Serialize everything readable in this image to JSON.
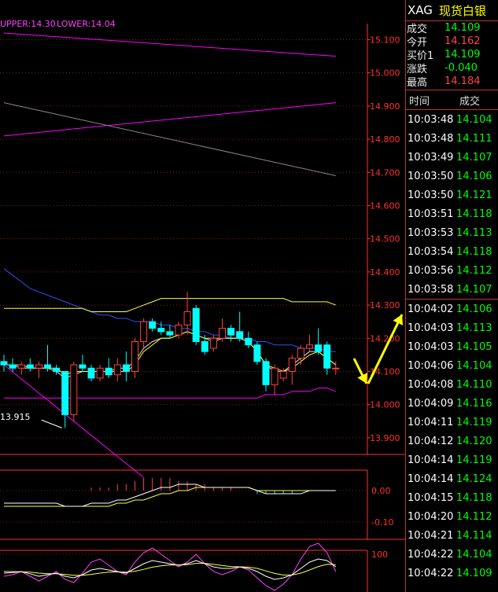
{
  "indicator": {
    "upper_label": "UPPER:14.30",
    "lower_label": "LOWER:14.04"
  },
  "colors": {
    "up": "#ff4040",
    "down": "#00ffff",
    "upper": "#ff00ff",
    "lower": "#ff00ff",
    "ma_yellow": "#ffff40",
    "ma_blue": "#3050ff",
    "axis": "#ff3030"
  },
  "chart_data": [
    {
      "type": "candlestick",
      "y_ticks": [
        "15.100",
        "15.000",
        "14.900",
        "14.800",
        "14.700",
        "14.600",
        "14.500",
        "14.400",
        "14.300",
        "14.200",
        "14.100",
        "14.000",
        "13.900"
      ],
      "ylim": [
        13.85,
        15.12
      ],
      "low_marker_label": "13.915",
      "candles": [
        {
          "o": 14.13,
          "h": 14.15,
          "l": 14.1,
          "c": 14.12
        },
        {
          "o": 14.12,
          "h": 14.14,
          "l": 14.1,
          "c": 14.11
        },
        {
          "o": 14.11,
          "h": 14.13,
          "l": 14.09,
          "c": 14.12
        },
        {
          "o": 14.12,
          "h": 14.14,
          "l": 14.1,
          "c": 14.11
        },
        {
          "o": 14.11,
          "h": 14.13,
          "l": 14.08,
          "c": 14.12
        },
        {
          "o": 14.12,
          "h": 14.18,
          "l": 14.1,
          "c": 14.11
        },
        {
          "o": 14.11,
          "h": 14.12,
          "l": 14.09,
          "c": 14.1
        },
        {
          "o": 14.1,
          "h": 14.1,
          "l": 13.93,
          "c": 13.97
        },
        {
          "o": 13.97,
          "h": 14.13,
          "l": 13.95,
          "c": 14.12
        },
        {
          "o": 14.12,
          "h": 14.15,
          "l": 14.1,
          "c": 14.11
        },
        {
          "o": 14.11,
          "h": 14.12,
          "l": 14.07,
          "c": 14.08
        },
        {
          "o": 14.08,
          "h": 14.12,
          "l": 14.07,
          "c": 14.11
        },
        {
          "o": 14.11,
          "h": 14.14,
          "l": 14.08,
          "c": 14.09
        },
        {
          "o": 14.09,
          "h": 14.14,
          "l": 14.07,
          "c": 14.12
        },
        {
          "o": 14.12,
          "h": 14.16,
          "l": 14.07,
          "c": 14.1
        },
        {
          "o": 14.1,
          "h": 14.2,
          "l": 14.08,
          "c": 14.19
        },
        {
          "o": 14.19,
          "h": 14.26,
          "l": 14.17,
          "c": 14.25
        },
        {
          "o": 14.25,
          "h": 14.26,
          "l": 14.22,
          "c": 14.23
        },
        {
          "o": 14.23,
          "h": 14.25,
          "l": 14.21,
          "c": 14.22
        },
        {
          "o": 14.22,
          "h": 14.24,
          "l": 14.2,
          "c": 14.21
        },
        {
          "o": 14.21,
          "h": 14.25,
          "l": 14.2,
          "c": 14.24
        },
        {
          "o": 14.24,
          "h": 14.34,
          "l": 14.21,
          "c": 14.28
        },
        {
          "o": 14.29,
          "h": 14.3,
          "l": 14.18,
          "c": 14.19
        },
        {
          "o": 14.19,
          "h": 14.21,
          "l": 14.15,
          "c": 14.16
        },
        {
          "o": 14.17,
          "h": 14.21,
          "l": 14.16,
          "c": 14.2
        },
        {
          "o": 14.2,
          "h": 14.26,
          "l": 14.19,
          "c": 14.23
        },
        {
          "o": 14.23,
          "h": 14.24,
          "l": 14.19,
          "c": 14.21
        },
        {
          "o": 14.22,
          "h": 14.28,
          "l": 14.19,
          "c": 14.2
        },
        {
          "o": 14.2,
          "h": 14.22,
          "l": 14.17,
          "c": 14.18
        },
        {
          "o": 14.18,
          "h": 14.19,
          "l": 14.12,
          "c": 14.13
        },
        {
          "o": 14.13,
          "h": 14.14,
          "l": 14.04,
          "c": 14.06
        },
        {
          "o": 14.06,
          "h": 14.12,
          "l": 14.03,
          "c": 14.11
        },
        {
          "o": 14.08,
          "h": 14.11,
          "l": 14.07,
          "c": 14.1
        },
        {
          "o": 14.1,
          "h": 14.15,
          "l": 14.06,
          "c": 14.14
        },
        {
          "o": 14.14,
          "h": 14.18,
          "l": 14.12,
          "c": 14.17
        },
        {
          "o": 14.17,
          "h": 14.21,
          "l": 14.16,
          "c": 14.18
        },
        {
          "o": 14.18,
          "h": 14.23,
          "l": 14.15,
          "c": 14.16
        },
        {
          "o": 14.18,
          "h": 14.19,
          "l": 14.09,
          "c": 14.11
        },
        {
          "o": 14.11,
          "h": 14.13,
          "l": 14.09,
          "c": 14.11
        }
      ],
      "bands": {
        "upper": [
          14.29,
          14.29,
          14.29,
          14.29,
          14.29,
          14.29,
          14.29,
          14.29,
          14.29,
          14.29,
          14.28,
          14.28,
          14.28,
          14.28,
          14.28,
          14.29,
          14.3,
          14.31,
          14.32,
          14.32,
          14.32,
          14.32,
          14.32,
          14.32,
          14.32,
          14.32,
          14.32,
          14.32,
          14.32,
          14.32,
          14.32,
          14.32,
          14.32,
          14.31,
          14.31,
          14.31,
          14.31,
          14.31,
          14.3
        ],
        "lower": [
          14.02,
          14.02,
          14.02,
          14.02,
          14.02,
          14.02,
          14.02,
          14.02,
          14.02,
          14.02,
          14.02,
          14.02,
          14.02,
          14.02,
          14.02,
          14.02,
          14.02,
          14.02,
          14.02,
          14.02,
          14.02,
          14.02,
          14.02,
          14.02,
          14.02,
          14.02,
          14.02,
          14.02,
          14.02,
          14.02,
          14.03,
          14.03,
          14.03,
          14.04,
          14.04,
          14.04,
          14.05,
          14.05,
          14.04
        ],
        "ma_blue": [
          14.41,
          14.39,
          14.37,
          14.35,
          14.34,
          14.33,
          14.32,
          14.31,
          14.3,
          14.29,
          14.28,
          14.27,
          14.27,
          14.26,
          14.26,
          14.25,
          14.25,
          14.25,
          14.24,
          14.24,
          14.23,
          14.23,
          14.22,
          14.22,
          14.21,
          14.21,
          14.2,
          14.2,
          14.2,
          14.19,
          14.19,
          14.18,
          14.18,
          14.18,
          14.17,
          14.17,
          14.17,
          14.16,
          14.16
        ],
        "ma_yellow": [
          14.12,
          14.12,
          14.12,
          14.11,
          14.11,
          14.11,
          14.11,
          14.09,
          14.1,
          14.1,
          14.1,
          14.1,
          14.1,
          14.1,
          14.1,
          14.12,
          14.16,
          14.18,
          14.2,
          14.2,
          14.21,
          14.22,
          14.21,
          14.2,
          14.2,
          14.2,
          14.2,
          14.2,
          14.19,
          14.16,
          14.12,
          14.11,
          14.1,
          14.11,
          14.13,
          14.15,
          14.16,
          14.14,
          14.12
        ],
        "ma_white": [
          14.12,
          14.12,
          14.11,
          14.11,
          14.11,
          14.11,
          14.1,
          14.08,
          14.09,
          14.1,
          14.1,
          14.1,
          14.1,
          14.11,
          14.11,
          14.13,
          14.17,
          14.19,
          14.2,
          14.2,
          14.21,
          14.22,
          14.21,
          14.2,
          14.19,
          14.2,
          14.2,
          14.2,
          14.19,
          14.16,
          14.12,
          14.1,
          14.1,
          14.12,
          14.14,
          14.16,
          14.16,
          14.14,
          14.12
        ]
      },
      "trend_lines": [
        {
          "from": [
            0,
            15.12
          ],
          "to": [
            38,
            15.05
          ],
          "color": "#ff00ff"
        },
        {
          "from": [
            0,
            14.81
          ],
          "to": [
            38,
            14.91
          ],
          "color": "#ff00ff"
        },
        {
          "from": [
            0,
            14.91
          ],
          "to": [
            38,
            14.69
          ],
          "color": "#888888"
        },
        {
          "from": [
            0,
            14.12
          ],
          "to": [
            16,
            13.78
          ],
          "color": "#ff00ff"
        }
      ]
    },
    {
      "type": "bar+line",
      "y_ticks": [
        "0.00",
        "-0.10"
      ],
      "ylim": [
        -0.14,
        0.06
      ],
      "bars": [
        0,
        0,
        0,
        0,
        0,
        0,
        0,
        0,
        0,
        0,
        0.01,
        0.01,
        0.01,
        0.02,
        0.02,
        0.03,
        0.04,
        0.04,
        0.04,
        0.04,
        0.03,
        0.03,
        0.02,
        0.02,
        0.01,
        0.01,
        0.01,
        0,
        0,
        -0.01,
        -0.01,
        -0.01,
        -0.01,
        -0.01,
        0,
        0,
        0,
        0,
        0
      ],
      "dif": [
        -0.04,
        -0.04,
        -0.04,
        -0.04,
        -0.04,
        -0.04,
        -0.04,
        -0.05,
        -0.05,
        -0.05,
        -0.04,
        -0.04,
        -0.04,
        -0.03,
        -0.03,
        -0.02,
        -0.01,
        0,
        0.01,
        0.01,
        0.02,
        0.02,
        0.02,
        0.01,
        0.01,
        0.01,
        0.01,
        0.01,
        0.01,
        0,
        -0.01,
        -0.01,
        -0.01,
        -0.01,
        -0.01,
        0,
        0,
        0,
        0
      ],
      "dea": [
        -0.05,
        -0.05,
        -0.05,
        -0.05,
        -0.05,
        -0.05,
        -0.05,
        -0.05,
        -0.05,
        -0.05,
        -0.05,
        -0.05,
        -0.05,
        -0.04,
        -0.04,
        -0.03,
        -0.03,
        -0.02,
        -0.01,
        -0.01,
        0,
        0,
        0.01,
        0.01,
        0.01,
        0.01,
        0.01,
        0.01,
        0.01,
        0,
        0,
        0,
        0,
        0,
        0,
        0,
        0,
        0,
        0
      ]
    },
    {
      "type": "line",
      "y_ticks": [
        "100"
      ],
      "ylim": [
        0,
        100
      ],
      "k": [
        40,
        42,
        45,
        38,
        30,
        35,
        40,
        30,
        25,
        35,
        50,
        55,
        50,
        45,
        40,
        55,
        70,
        80,
        75,
        70,
        65,
        70,
        80,
        70,
        60,
        55,
        55,
        60,
        55,
        45,
        30,
        20,
        25,
        35,
        55,
        75,
        85,
        80,
        60
      ],
      "d": [
        45,
        45,
        44,
        43,
        40,
        38,
        38,
        36,
        33,
        33,
        36,
        40,
        43,
        44,
        43,
        46,
        52,
        59,
        63,
        66,
        66,
        67,
        71,
        71,
        68,
        64,
        61,
        60,
        59,
        55,
        47,
        39,
        34,
        34,
        40,
        50,
        61,
        68,
        67
      ],
      "j": [
        30,
        35,
        45,
        30,
        15,
        30,
        45,
        20,
        10,
        40,
        75,
        85,
        65,
        45,
        35,
        75,
        105,
        120,
        100,
        80,
        60,
        75,
        100,
        70,
        45,
        35,
        45,
        60,
        50,
        25,
        0,
        -15,
        5,
        35,
        85,
        125,
        135,
        105,
        45
      ]
    }
  ],
  "side": {
    "symbol": "XAG",
    "name": "现货白银",
    "quotes": [
      {
        "label": "成交",
        "value": "14.109",
        "cls": "g"
      },
      {
        "label": "今开",
        "value": "14.162",
        "cls": "r"
      },
      {
        "label": "买价1",
        "value": "14.109",
        "cls": "g"
      },
      {
        "label": "涨跌",
        "value": "-0.040",
        "cls": "g"
      },
      {
        "label": "最高",
        "value": "14.184",
        "cls": "r"
      }
    ],
    "table_header": {
      "time": "时间",
      "price": "成交"
    },
    "ticks": [
      {
        "t": "10:03:48",
        "p": "14.104"
      },
      {
        "t": "10:03:48",
        "p": "14.111"
      },
      {
        "t": "10:03:49",
        "p": "14.107"
      },
      {
        "t": "10:03:50",
        "p": "14.106"
      },
      {
        "t": "10:03:50",
        "p": "14.121"
      },
      {
        "t": "10:03:51",
        "p": "14.118"
      },
      {
        "t": "10:03:53",
        "p": "14.113"
      },
      {
        "t": "10:03:54",
        "p": "14.118"
      },
      {
        "t": "10:03:56",
        "p": "14.112"
      },
      {
        "t": "10:03:58",
        "p": "14.107"
      },
      {
        "t": "10:04:02",
        "p": "14.106"
      },
      {
        "t": "10:04:03",
        "p": "14.113"
      },
      {
        "t": "10:04:03",
        "p": "14.105"
      },
      {
        "t": "10:04:06",
        "p": "14.104"
      },
      {
        "t": "10:04:08",
        "p": "14.110"
      },
      {
        "t": "10:04:09",
        "p": "14.116"
      },
      {
        "t": "10:04:11",
        "p": "14.119"
      },
      {
        "t": "10:04:12",
        "p": "14.120"
      },
      {
        "t": "10:04:14",
        "p": "14.119"
      },
      {
        "t": "10:04:14",
        "p": "14.124"
      },
      {
        "t": "10:04:15",
        "p": "14.118"
      },
      {
        "t": "10:04:20",
        "p": "14.112"
      },
      {
        "t": "10:04:21",
        "p": "14.114"
      },
      {
        "t": "10:04:22",
        "p": "14.104"
      },
      {
        "t": "10:04:22",
        "p": "14.109"
      }
    ]
  }
}
